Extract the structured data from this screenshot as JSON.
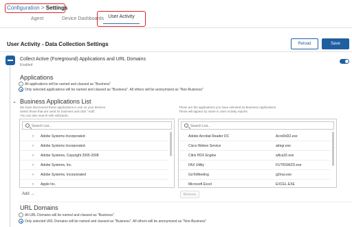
{
  "breadcrumb": {
    "configuration": "Configuration",
    "separator": " > ",
    "settings": "Settings"
  },
  "tabs": {
    "agent": "Agent",
    "device_dashboards": "Device Dashboards",
    "user_activity": "User Activity"
  },
  "header": {
    "title": "User Activity - Data Collection Settings",
    "reload_label": "Reload",
    "save_label": "Save"
  },
  "collect": {
    "title": "Collect Active (Foreground) Applications and URL Domains",
    "status": "Enabled",
    "enabled": true
  },
  "applications": {
    "title": "Applications",
    "option_all": "All applications will be named and classed as \"Business\"",
    "option_selected": "Only selected applications will be named and classed as \"Business\". All others will be anonymized as \"Non-Business\"",
    "selected": "option_selected"
  },
  "business_list": {
    "title": "Business Applications List",
    "left_desc": [
      "We have discovered these applications in use on your devices.",
      "Select those that are used for business and click \"Add\".",
      "You can also search with wildcards."
    ],
    "right_desc": [
      "These are the applications you have selected as Business Applications.",
      "These will appear by name in User Activity reports."
    ],
    "search_placeholder": "Search List...",
    "discovered": [
      "Adobe Systems Incorporated",
      "Adobe Systems Incorporated.",
      "Adobe Systems, Copyright 2005-2008",
      "Adobe Systems, Inc.",
      "Adobe Systems, Incorporated",
      "Apple Inc."
    ],
    "selected_apps": [
      {
        "name": "Adobe Acrobat Reader DC",
        "exe": "AcroRd32.exe"
      },
      {
        "name": "Cisco Webex Service",
        "exe": "atmgr.exe"
      },
      {
        "name": "Citrix HDX Engine",
        "exe": "wfica32.exe"
      },
      {
        "name": "FAX Utility",
        "exe": "FUTRSWZD.exe"
      },
      {
        "name": "GoToMeeting",
        "exe": "g2mui.exe"
      },
      {
        "name": "Microsoft Excel",
        "exe": "EXCEL.EXE"
      }
    ],
    "add_label": "Add →",
    "remove_label": "Remove"
  },
  "url_domains": {
    "title": "URL Domains",
    "option_all": "All URL Domains will be named and classed as \"Business\"",
    "option_selected": "Only selected URL Domains will be named and classed as \"Business\". All others will be anonymized as \"Non-Business\"",
    "selected": "option_selected"
  },
  "colors": {
    "accent": "#1f5fa0",
    "highlight": "#d9232d",
    "link": "#2f6fa8"
  },
  "icons": {
    "collapse": "minus-square-icon",
    "toggle": "toggle-on-icon",
    "search": "search-icon",
    "expand": "chevron-right-icon",
    "section": "chevron-down-icon"
  }
}
